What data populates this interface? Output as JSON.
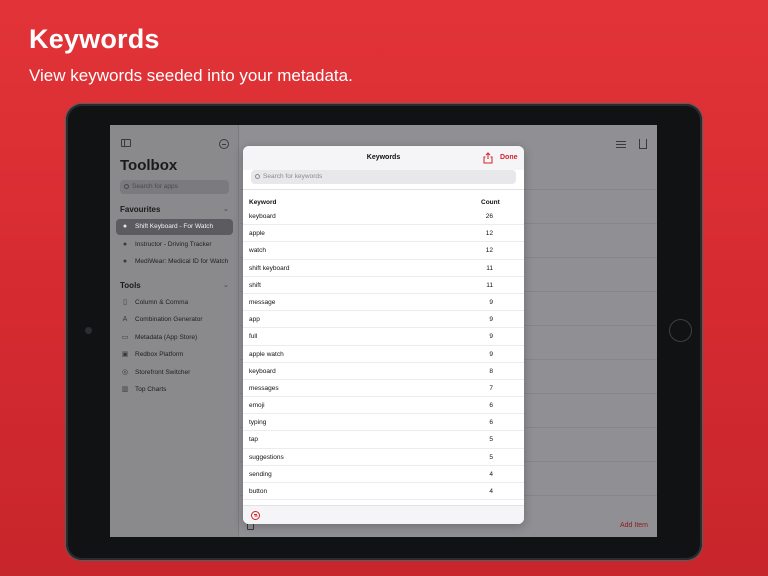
{
  "hero": {
    "title": "Keywords",
    "subtitle": "View keywords seeded into your metadata."
  },
  "sidebar": {
    "title": "Toolbox",
    "search_placeholder": "Search for apps",
    "favourites_label": "Favourites",
    "favourites": [
      {
        "label": "Shift Keyboard - For Watch",
        "icon": "apple-icon",
        "selected": true
      },
      {
        "label": "Instructor - Driving Tracker",
        "icon": "apple-icon",
        "selected": false
      },
      {
        "label": "MediWear: Medical ID for Watch",
        "icon": "apple-icon",
        "selected": false
      }
    ],
    "tools_label": "Tools",
    "tools": [
      {
        "label": "Column & Comma",
        "icon": "columns-icon"
      },
      {
        "label": "Combination Generator",
        "icon": "text-icon"
      },
      {
        "label": "Metadata (App Store)",
        "icon": "document-icon"
      },
      {
        "label": "Redbox Platform",
        "icon": "box-icon"
      },
      {
        "label": "Storefront Switcher",
        "icon": "globe-icon"
      },
      {
        "label": "Top Charts",
        "icon": "chart-icon"
      }
    ]
  },
  "main": {
    "add_item_label": "Add Item"
  },
  "modal": {
    "title": "Keywords",
    "done_label": "Done",
    "search_placeholder": "Search for keywords",
    "columns": {
      "keyword": "Keyword",
      "count": "Count"
    },
    "rows": [
      {
        "keyword": "keyboard",
        "count": "26"
      },
      {
        "keyword": "apple",
        "count": "12"
      },
      {
        "keyword": "watch",
        "count": "12"
      },
      {
        "keyword": "shift keyboard",
        "count": "11"
      },
      {
        "keyword": "shift",
        "count": "11"
      },
      {
        "keyword": "message",
        "count": "9"
      },
      {
        "keyword": "app",
        "count": "9"
      },
      {
        "keyword": "full",
        "count": "9"
      },
      {
        "keyword": "apple watch",
        "count": "9"
      },
      {
        "keyword": "keyboard",
        "count": "8"
      },
      {
        "keyword": "messages",
        "count": "7"
      },
      {
        "keyword": "emoji",
        "count": "6"
      },
      {
        "keyword": "typing",
        "count": "6"
      },
      {
        "keyword": "tap",
        "count": "5"
      },
      {
        "keyword": "suggestions",
        "count": "5"
      },
      {
        "keyword": "sending",
        "count": "4"
      },
      {
        "keyword": "button",
        "count": "4"
      }
    ]
  },
  "colors": {
    "accent": "#d0242a",
    "background": "#e23438"
  }
}
